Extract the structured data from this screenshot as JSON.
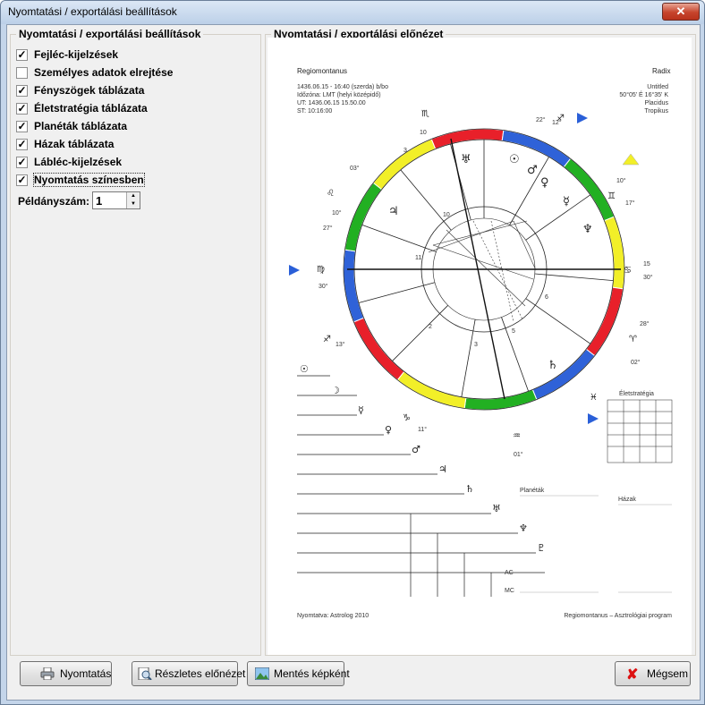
{
  "window": {
    "title": "Nyomtatási / exportálási beállítások",
    "close_label": "✕"
  },
  "settings_group": {
    "legend": "Nyomtatási / exportálási beállítások",
    "options": [
      {
        "label": "Fejléc-kijelzések",
        "checked": true
      },
      {
        "label": "Személyes adatok elrejtése",
        "checked": false
      },
      {
        "label": "Fényszögek táblázata",
        "checked": true
      },
      {
        "label": "Életstratégia táblázata",
        "checked": true
      },
      {
        "label": "Planéták táblázata",
        "checked": true
      },
      {
        "label": "Házak táblázata",
        "checked": true
      },
      {
        "label": "Lábléc-kijelzések",
        "checked": true
      },
      {
        "label": "Nyomtatás színesben",
        "checked": true
      }
    ],
    "copies_label": "Példányszám:",
    "copies_value": "1"
  },
  "preview_group": {
    "legend": "Nyomtatási / exportálási előnézet",
    "chart_header": {
      "system": "Regiomontanus",
      "type": "Radix",
      "info_lines": [
        "1436.06.15 - 16:40 (szerda) b/bo",
        "Időzóna: LMT (helyi középidő)",
        "UT: 1436.06.15  15.50.00",
        "ST: 10:16:00"
      ],
      "place_lines": [
        "Untitled",
        "50°05' É 16°35' K",
        "Placidus",
        "Tropikus"
      ]
    },
    "life_strategy_title": "Életstratégia",
    "planets_title": "Planéták",
    "houses_title": "Házak",
    "ac_label": "AC",
    "mc_label": "MC",
    "footer_left": "Nyomtatva: Astrolog 2010",
    "footer_right": "Regiomontanus – Asztrológiai program"
  },
  "buttons": {
    "print": "Nyomtatás",
    "detailed_preview": "Részletes előnézet",
    "save_image": "Mentés képként",
    "cancel": "Mégsem"
  },
  "colors": {
    "red": "#e8202a",
    "blue": "#2f62d8",
    "green": "#22b022",
    "yellow": "#f2ef28",
    "accent_blue": "#2a5fd8",
    "cancel_x": "#d11"
  }
}
